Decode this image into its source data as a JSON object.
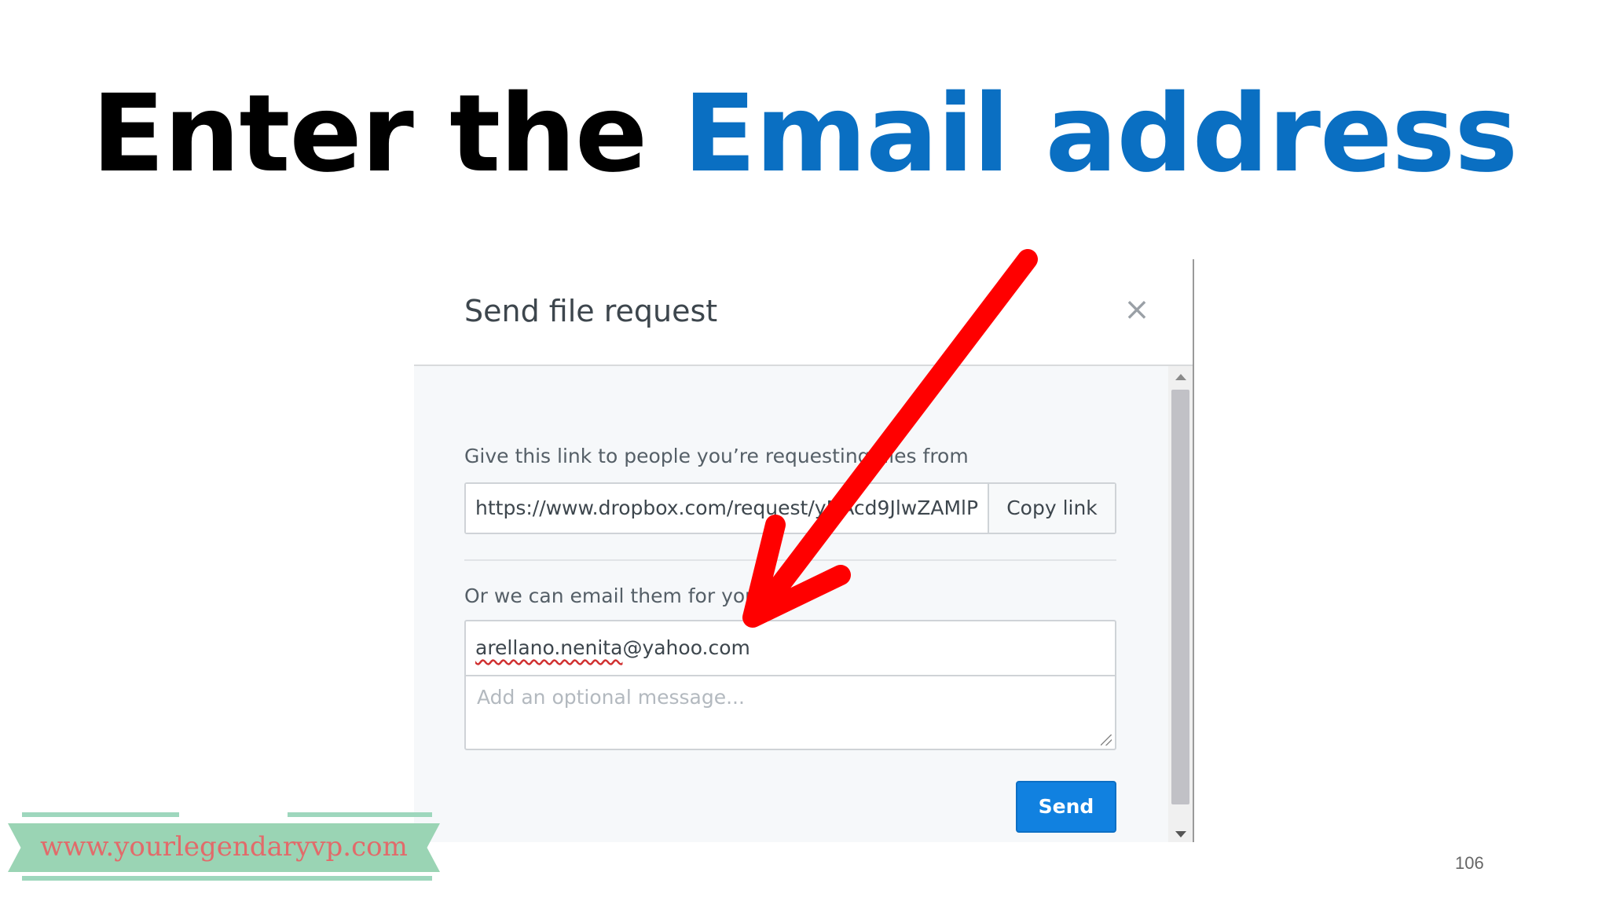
{
  "slide": {
    "title_plain": "Enter the ",
    "title_accent": "Email address",
    "page_number": "106"
  },
  "dialog": {
    "title": "Send file request",
    "close_symbol": "×",
    "link_label": "Give this link to people you’re requesting files from",
    "link_value": "https://www.dropbox.com/request/yNAcd9JlwZAMlP",
    "copy_link_label": "Copy link",
    "email_label": "Or we can email them for you",
    "email_value_local": "arellano.nenita",
    "email_value_domain": "@yahoo.com",
    "message_placeholder": "Add an optional message...",
    "send_label": "Send"
  },
  "banner": {
    "text": "www.yourlegendaryvp.com"
  },
  "colors": {
    "accent_blue": "#0a6fc2",
    "arrow_red": "#ff0000",
    "send_button": "#1181e0",
    "banner_green": "#9ad4b4",
    "banner_text": "#e26a6a"
  },
  "icons": {
    "close": "close-icon",
    "annotation_arrow": "red-arrow-icon"
  }
}
